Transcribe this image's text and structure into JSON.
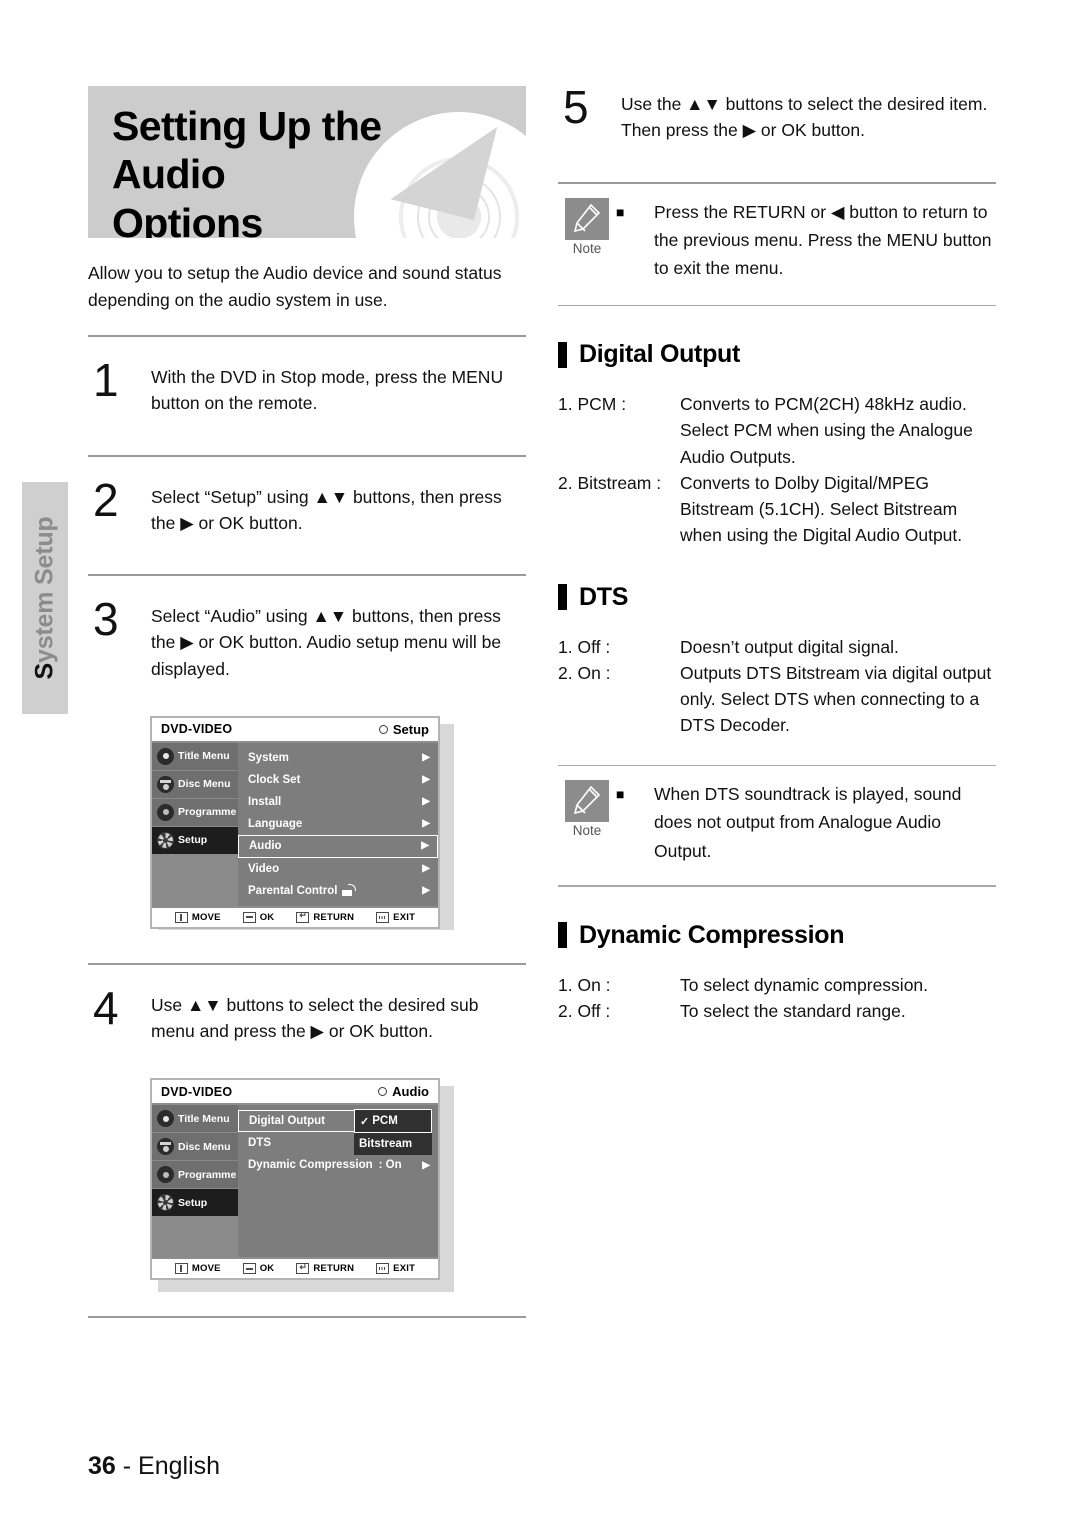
{
  "page": {
    "number": "36",
    "separator": "-",
    "language": "English",
    "side_tab": "System Setup",
    "side_tab_first_letter": "S",
    "side_tab_rest": "ystem Setup"
  },
  "title": {
    "line1": "Setting Up the Audio",
    "line2": "Options",
    "intro": "Allow you to setup the Audio device and sound status depending on the audio system in use."
  },
  "steps": [
    {
      "number": "1",
      "text": "With the DVD in Stop mode, press the MENU button on the remote."
    },
    {
      "number": "2",
      "text": "Select “Setup” using ▲▼ buttons, then press the ▶ or OK button."
    },
    {
      "number": "3",
      "text": "Select “Audio” using ▲▼ buttons, then press the ▶ or OK button. Audio setup menu will be displayed."
    },
    {
      "number": "4",
      "text": "Use ▲▼ buttons to select the desired sub menu and press the ▶ or OK button."
    },
    {
      "number": "5",
      "text": "Use the ▲▼ buttons to select the desired item. Then press the ▶ or OK button."
    }
  ],
  "osd_setup": {
    "brand": "DVD-VIDEO",
    "screen_name": "Setup",
    "sidebar": [
      {
        "label": "Title Menu",
        "icon": "disc-dot-icon",
        "active": false
      },
      {
        "label": "Disc Menu",
        "icon": "disc-menu-icon",
        "active": false
      },
      {
        "label": "Programme",
        "icon": "programme-disc-icon",
        "active": false
      },
      {
        "label": "Setup",
        "icon": "gear-icon",
        "active": true
      }
    ],
    "rows": [
      {
        "label": "System",
        "selected": false,
        "arrow": "▶"
      },
      {
        "label": "Clock Set",
        "selected": false,
        "arrow": "▶"
      },
      {
        "label": "Install",
        "selected": false,
        "arrow": "▶"
      },
      {
        "label": "Language",
        "selected": false,
        "arrow": "▶"
      },
      {
        "label": "Audio",
        "selected": true,
        "arrow": "▶"
      },
      {
        "label": "Video",
        "selected": false,
        "arrow": "▶"
      },
      {
        "label": "Parental Control",
        "selected": false,
        "arrow": "▶",
        "icon": "unlocked-padlock-icon"
      }
    ],
    "buttons": [
      {
        "label": "MOVE",
        "icon": "updown-button-icon"
      },
      {
        "label": "OK",
        "icon": "enter-button-icon"
      },
      {
        "label": "RETURN",
        "icon": "return-button-icon"
      },
      {
        "label": "EXIT",
        "icon": "exit-button-icon"
      }
    ]
  },
  "osd_audio": {
    "brand": "DVD-VIDEO",
    "screen_name": "Audio",
    "sidebar": [
      {
        "label": "Title Menu",
        "icon": "disc-dot-icon",
        "active": false
      },
      {
        "label": "Disc Menu",
        "icon": "disc-menu-icon",
        "active": false
      },
      {
        "label": "Programme",
        "icon": "programme-disc-icon",
        "active": false
      },
      {
        "label": "Setup",
        "icon": "gear-icon",
        "active": true
      }
    ],
    "rows": [
      {
        "label": "Digital Output",
        "selected": true
      },
      {
        "label": "DTS",
        "selected": false
      },
      {
        "label": "Dynamic Compression",
        "value": ": On",
        "arrow": "▶",
        "selected": false
      }
    ],
    "popup": {
      "items": [
        {
          "label": "PCM",
          "checked": true,
          "check": "✓"
        },
        {
          "label": "Bitstream",
          "checked": false
        }
      ]
    },
    "buttons": [
      {
        "label": "MOVE",
        "icon": "updown-button-icon"
      },
      {
        "label": "OK",
        "icon": "enter-button-icon"
      },
      {
        "label": "RETURN",
        "icon": "return-button-icon"
      },
      {
        "label": "EXIT",
        "icon": "exit-button-icon"
      }
    ]
  },
  "notes": [
    {
      "badge": "Note",
      "bullet": "■",
      "text": "Press the RETURN or ◀ button to return to the previous menu. Press the MENU button to exit the menu."
    },
    {
      "badge": "Note",
      "bullet": "■",
      "text": "When DTS soundtrack is played, sound does not output from Analogue Audio Output."
    }
  ],
  "sections": [
    {
      "title": "Digital Output",
      "items": [
        {
          "term": "1. PCM :",
          "desc": "Converts to PCM(2CH) 48kHz audio. Select PCM when using the Analogue Audio Outputs."
        },
        {
          "term": "2. Bitstream :",
          "desc": "Converts to Dolby Digital/MPEG Bitstream (5.1CH). Select Bitstream when using the Digital Audio Output."
        }
      ]
    },
    {
      "title": "DTS",
      "items": [
        {
          "term": "1. Off :",
          "desc": "Doesn’t output digital signal."
        },
        {
          "term": "2. On :",
          "desc": "Outputs DTS Bitstream via digital output only. Select DTS when connecting to a DTS Decoder."
        }
      ]
    },
    {
      "title": "Dynamic Compression",
      "items": [
        {
          "term": "1. On :",
          "desc": "To select dynamic compression."
        },
        {
          "term": "2. Off :",
          "desc": "To select the standard range."
        }
      ]
    }
  ],
  "colors": {
    "header_bg": "#cccccc",
    "side_tab_bg": "#cfcfcf",
    "note_badge": "#8c8c8c",
    "osd_bg": "#7d7d7d",
    "osd_active": "#1d1d1d"
  }
}
